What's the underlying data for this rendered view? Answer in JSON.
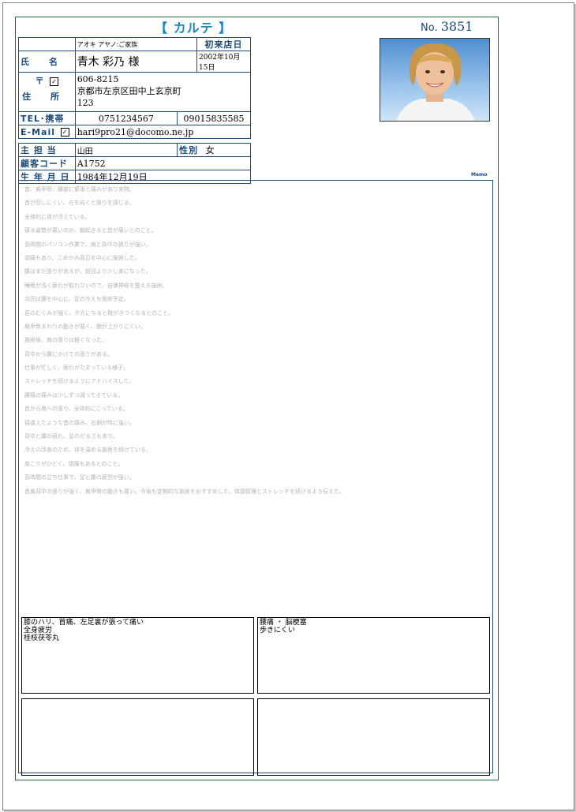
{
  "header": {
    "title": "【 カルテ 】",
    "number_label": "No.",
    "number": "3851"
  },
  "patient": {
    "furigana": "アオキ アヤノ:ご家族",
    "first_visit_label": "初来店日",
    "name_label": "氏　　名",
    "name": "青木 彩乃 様",
    "first_visit_date": "2002年10月15日",
    "postal_label": "〒",
    "postal_check": "✓",
    "address_label": "住　　所",
    "postal_code": "606-8215",
    "address1": "京都市左京区田中上玄京町",
    "address2": "123",
    "phone_label": "TEL･携帯",
    "tel": "0751234567",
    "mobile": "09015835585",
    "email_label": "E-Mail",
    "email_check": "✓",
    "email": "hari9pro21@docomo.ne.jp",
    "staff_label": "主 担 当",
    "staff": "山田",
    "gender_label": "性別",
    "gender": "女",
    "customer_code_label": "顧客コード",
    "customer_code": "A1752",
    "birthday_label": "生 年 月 日",
    "birthday": "1984年12月19日"
  },
  "memo": {
    "label": "Memo",
    "lines": [
      "首、肩甲骨、腰部に緊張と痛みがあり来院。",
      "首が回しにくい、右を向くと張りを感じる。",
      "全体的に体が冷えている。",
      "寝る姿勢が悪いのか、朝起きると首が痛いとのこと。",
      "長時間のパソコン作業で、肩と背中の張りが強い。",
      "頭痛もあり、こめかみ周辺を中心に施術した。",
      "腰はまだ張りがあるが、前回より少し楽になった。",
      "睡眠が浅く疲れが取れないので、自律神経を整える施術。",
      "次回は腰を中心に、足の冷えも施術予定。",
      "足のむくみが強く、夕方になると靴がきつくなるとのこと。",
      "肩甲骨まわりの動きが悪く、腕が上がりにくい。",
      "施術後、肩の張りは軽くなった。",
      "背中から腰にかけての張りがある。",
      "仕事が忙しく、疲れがたまっている様子。",
      "ストレッチを続けるようにアドバイスした。",
      "腰痛の痛みは少しずつ減ってきている。",
      "首から肩への張り、全体的にこっている。",
      "寝違えたような首の痛み、右側が特に強い。",
      "背中と腰の疲れ、足のだるさもあり。",
      "冷えの改善のため、体を温める施術を続けている。",
      "肩こりがひどく、頭痛もあるとのこと。",
      "長時間の立ち仕事で、足と腰の疲労が強い。",
      "首肩背中の張りが強く、肩甲骨の動きも悪い。今後も定期的な施術をおすすめした。体調管理とストレッチを続けるよう伝えた。"
    ]
  },
  "notes": {
    "box1": [
      "膝のハリ、首痛、左足裏が張って痛い",
      "全身疲労",
      "桂枝茯苓丸"
    ],
    "box2": [
      "腰痛 ・ 脳梗塞",
      "歩きにくい"
    ],
    "box3": [],
    "box4": []
  }
}
